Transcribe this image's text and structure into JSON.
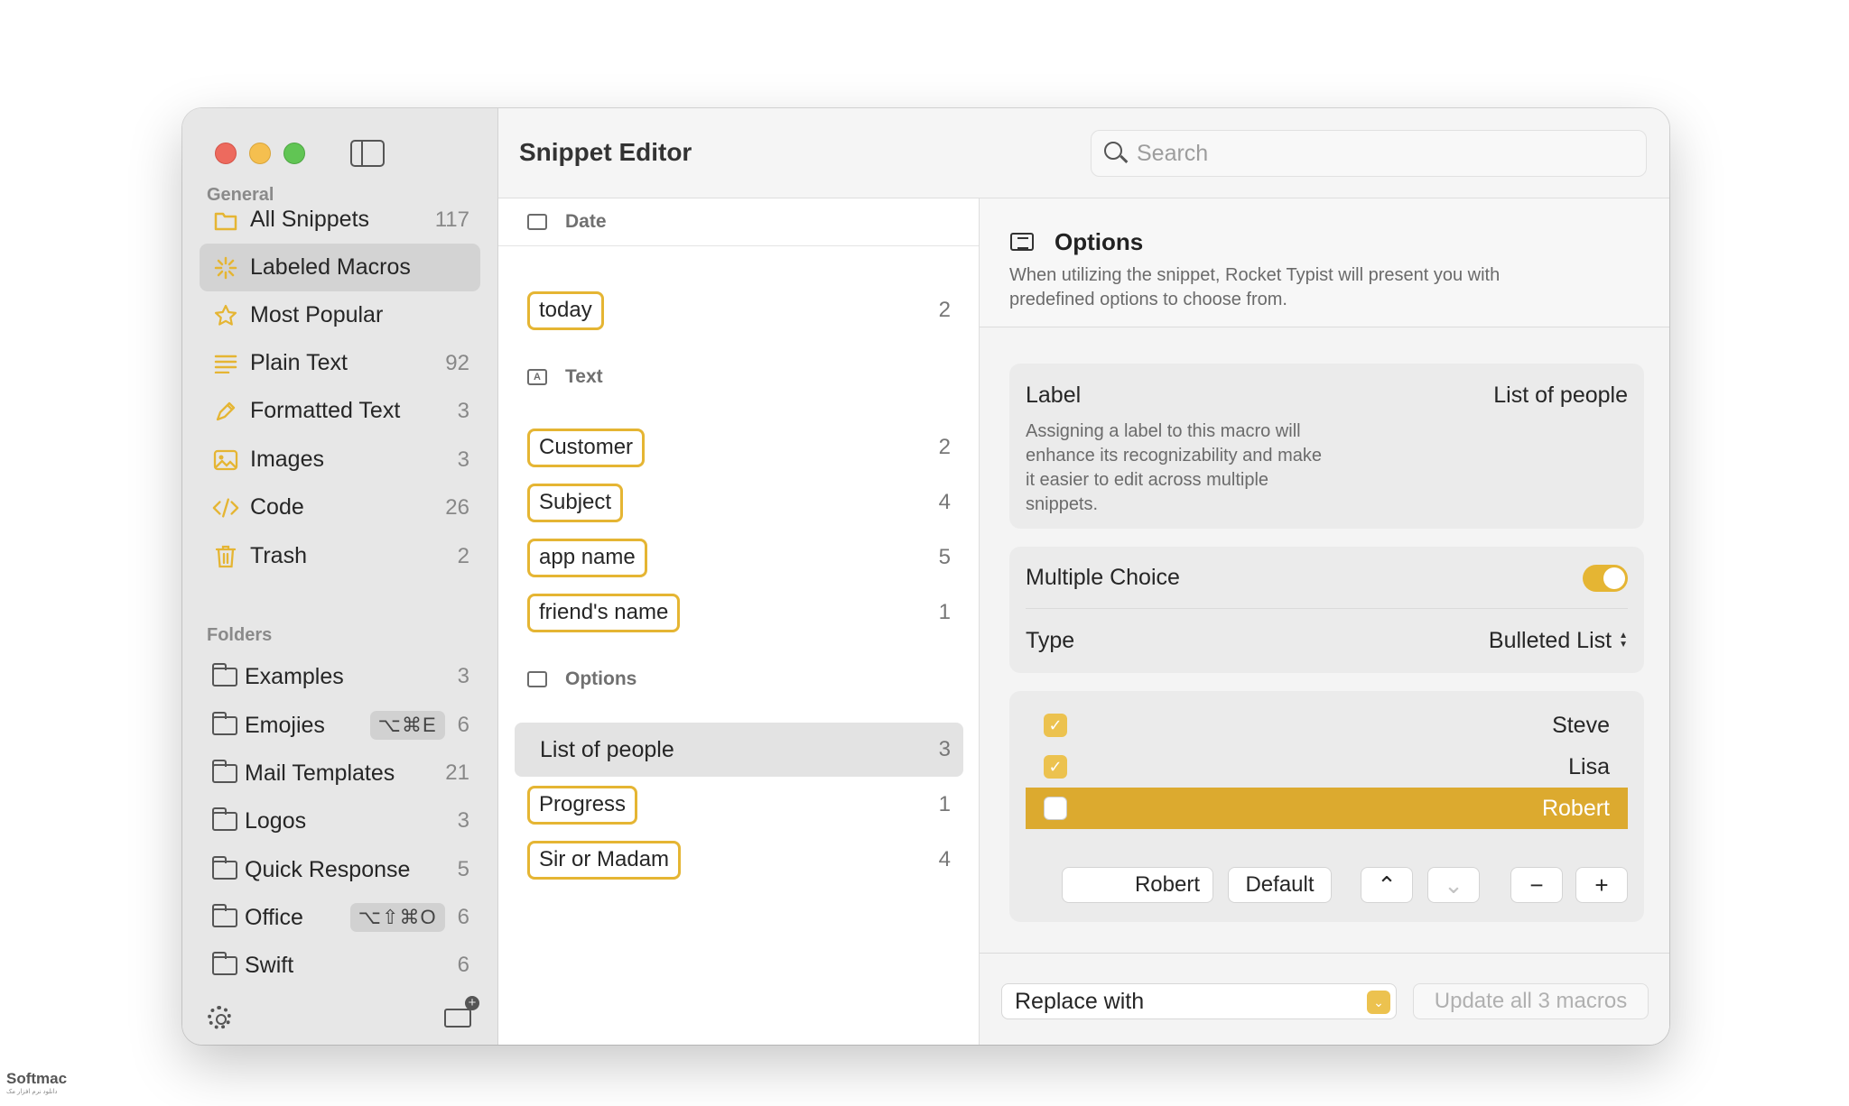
{
  "sidebar": {
    "general_title": "General",
    "items": [
      {
        "label": "All Snippets",
        "count": "117",
        "icon": "folder-icon"
      },
      {
        "label": "Labeled Macros",
        "count": "",
        "icon": "sparkle-icon"
      },
      {
        "label": "Most Popular",
        "count": "",
        "icon": "star-icon"
      },
      {
        "label": "Plain Text",
        "count": "92",
        "icon": "lines-icon"
      },
      {
        "label": "Formatted Text",
        "count": "3",
        "icon": "pen-icon"
      },
      {
        "label": "Images",
        "count": "3",
        "icon": "image-icon"
      },
      {
        "label": "Code",
        "count": "26",
        "icon": "code-icon"
      },
      {
        "label": "Trash",
        "count": "2",
        "icon": "trash-icon"
      }
    ],
    "folders_title": "Folders",
    "folders": [
      {
        "label": "Examples",
        "shortcut": "",
        "count": "3"
      },
      {
        "label": "Emojies",
        "shortcut": "⌥⌘E",
        "count": "6"
      },
      {
        "label": "Mail Templates",
        "shortcut": "",
        "count": "21"
      },
      {
        "label": "Logos",
        "shortcut": "",
        "count": "3"
      },
      {
        "label": "Quick Response",
        "shortcut": "",
        "count": "5"
      },
      {
        "label": "Office",
        "shortcut": "⌥⇧⌘O",
        "count": "6"
      },
      {
        "label": "Swift",
        "shortcut": "",
        "count": "6"
      }
    ]
  },
  "header": {
    "title": "Snippet Editor",
    "search_placeholder": "Search"
  },
  "macro_list": {
    "groups": [
      {
        "title": "Date",
        "rows": [
          {
            "label": "today",
            "count": "2"
          }
        ]
      },
      {
        "title": "Text",
        "rows": [
          {
            "label": "Customer",
            "count": "2"
          },
          {
            "label": "Subject",
            "count": "4"
          },
          {
            "label": "app name",
            "count": "5"
          },
          {
            "label": "friend's name",
            "count": "1"
          }
        ]
      },
      {
        "title": "Options",
        "rows": [
          {
            "label": "List of people",
            "count": "3"
          },
          {
            "label": "Progress",
            "count": "1"
          },
          {
            "label": "Sir or Madam",
            "count": "4"
          }
        ]
      }
    ]
  },
  "options_panel": {
    "title": "Options",
    "description": "When utilizing the snippet, Rocket Typist will present you with predefined options to choose from.",
    "label_name": "Label",
    "label_value": "List of people",
    "label_description": "Assigning a label to this macro will enhance its recognizability and make it easier to edit across multiple snippets.",
    "multiple_choice_label": "Multiple Choice",
    "multiple_choice_on": true,
    "type_label": "Type",
    "type_value": "Bulleted List",
    "list": [
      {
        "name": "Steve",
        "checked": true,
        "check_mark": "✓"
      },
      {
        "name": "Lisa",
        "checked": true,
        "check_mark": "✓"
      },
      {
        "name": "Robert",
        "checked": false,
        "check_mark": ""
      }
    ],
    "name_field_value": "Robert",
    "default_button": "Default",
    "move_up": "⌃",
    "move_down": "⌄",
    "remove": "−",
    "add": "+"
  },
  "bottom": {
    "replace_with": "Replace with",
    "replace_chevron": "⌄",
    "update_button": "Update all 3 macros"
  },
  "watermark": {
    "brand": "Softmac",
    "subtitle": "دانلود نرم افزار مک"
  },
  "colors": {
    "accent": "#e5b533",
    "selected_row": "#dcaa2f",
    "sidebar_bg": "#e7e7e7"
  }
}
